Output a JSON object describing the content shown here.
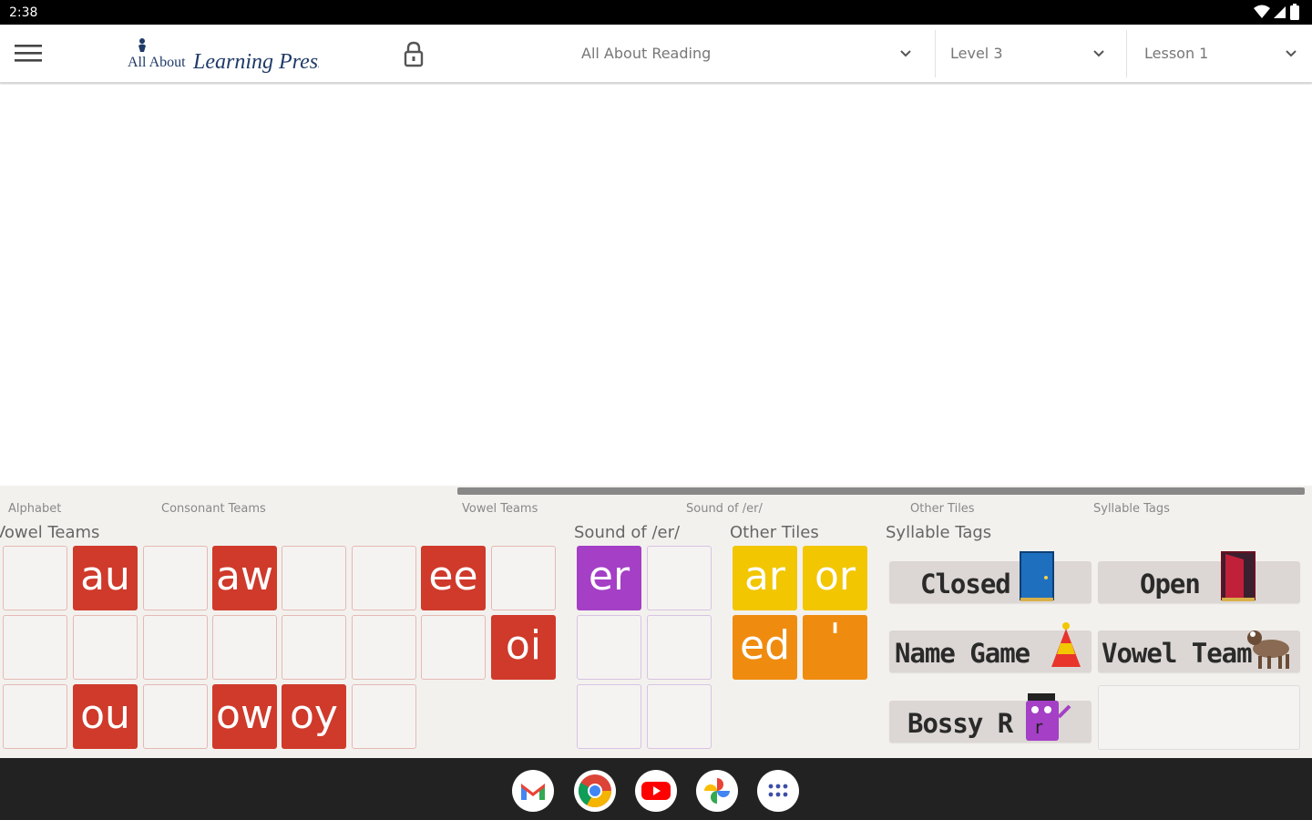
{
  "status": {
    "time": "2:38"
  },
  "header": {
    "logo_text_a": "All About",
    "logo_text_b": "Learning Press",
    "program": "All About Reading",
    "level": "Level 3",
    "lesson": "Lesson 1"
  },
  "nav_tabs": [
    "Alphabet",
    "Consonant Teams",
    "Vowel Teams",
    "Sound of /er/",
    "Other Tiles",
    "Syllable Tags"
  ],
  "sections": {
    "vowel_teams": "Vowel Teams",
    "sound_er": "Sound of /er/",
    "other_tiles": "Other Tiles",
    "syllable_tags": "Syllable Tags"
  },
  "vowel_tiles": {
    "row1": [
      "",
      "au",
      "",
      "aw",
      "",
      "",
      "ee",
      ""
    ],
    "row2": [
      "",
      "",
      "",
      "",
      "",
      "",
      "",
      "oi"
    ],
    "row3": [
      "",
      "ou",
      "",
      "ow",
      "oy",
      ""
    ]
  },
  "er_tiles": {
    "filled": "er"
  },
  "other_tiles": {
    "t1": "ar",
    "t2": "or",
    "t3": "ed",
    "t4": "'"
  },
  "syllable_tags": {
    "closed": "Closed",
    "open": "Open",
    "name_game": "Name Game",
    "vowel_team": "Vowel Team",
    "bossy_r": "Bossy R"
  },
  "colors": {
    "vowel_team": "#cf3a2b",
    "sound_er": "#a43fc6",
    "other_yellow": "#f2c600",
    "other_orange": "#ef8c10"
  },
  "dock": [
    "gmail-icon",
    "chrome-icon",
    "youtube-icon",
    "photos-icon",
    "app-drawer-icon"
  ]
}
